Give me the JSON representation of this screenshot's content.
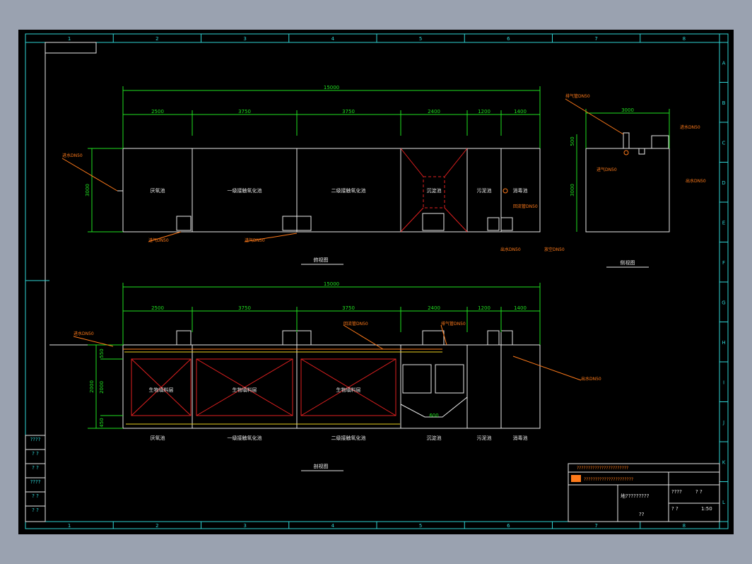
{
  "colors": {
    "background": "#000000",
    "window": "#9aa2b0",
    "frame": "#2fd5d5",
    "outline": "#e8e8e8",
    "dimension": "#20e020",
    "leader": "#ff7a1a",
    "diagonal": "#e02020"
  },
  "grid": {
    "columns": [
      "1",
      "2",
      "3",
      "4",
      "5",
      "6",
      "7",
      "8"
    ],
    "rows": [
      "A",
      "B",
      "C",
      "D",
      "E",
      "F",
      "G",
      "H",
      "I",
      "J",
      "K",
      "L"
    ]
  },
  "views": {
    "plan_title": "俯视图",
    "side_title": "侧视图",
    "section_title": "剖视图"
  },
  "dims": {
    "total": "15000",
    "segments": [
      "2500",
      "3750",
      "3750",
      "2400",
      "1200",
      "1400"
    ],
    "height": "3000",
    "side_width": "3000",
    "side_top": "500",
    "small": "500",
    "sec_550": "550",
    "sec_2000": "2000",
    "sec_450": "450",
    "s_600": "600",
    "s_300": "300"
  },
  "tanks": [
    "厌氧池",
    "一级接触氧化池",
    "二级接触氧化池",
    "沉淀池",
    "污泥池",
    "消毒池"
  ],
  "media_label": "生物填料层",
  "leaders": {
    "inlet": "进水DN50",
    "overflow": "排气管DN50",
    "outlet_sludge": "排泥DN50",
    "air": "进气DN50",
    "return": "回流管DN50",
    "drain": "放空DN50",
    "out": "出水DN50"
  },
  "title_block": {
    "company_line1": "???????????????????????",
    "company_line2": "??????????????????????",
    "drawing_title": "地?????????",
    "sub": "??",
    "left_labels": [
      "????",
      "? ?",
      "? ?",
      "????",
      "? ?",
      "? ?"
    ],
    "right_cells": [
      "????",
      "? ?",
      "? ?",
      "1:50"
    ]
  }
}
